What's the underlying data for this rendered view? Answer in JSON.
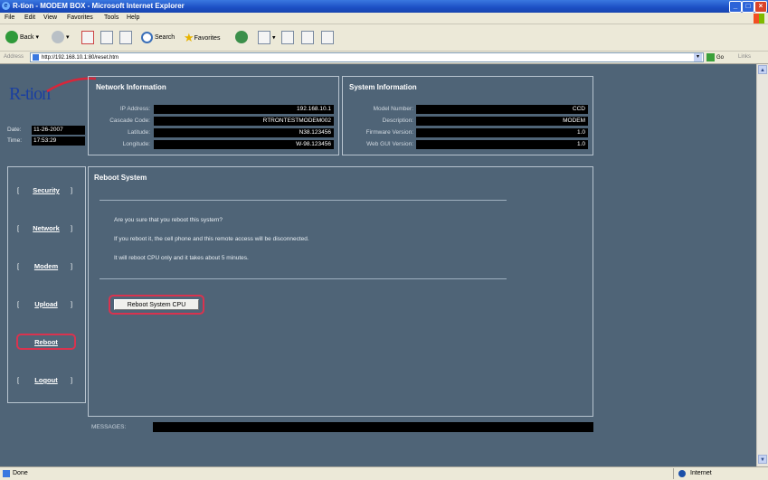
{
  "window": {
    "title": "R-tion - MODEM BOX - Microsoft Internet Explorer"
  },
  "menu": [
    "File",
    "Edit",
    "View",
    "Favorites",
    "Tools",
    "Help"
  ],
  "toolbar": {
    "back": "Back",
    "search": "Search",
    "favorites": "Favorites"
  },
  "address": {
    "label": "Address",
    "url": "http://192.168.10.1:80/reset.htm",
    "go": "Go",
    "links": "Links"
  },
  "status": {
    "text": "Done",
    "zone": "Internet"
  },
  "brand": {
    "logo": "R-tion"
  },
  "datetime": {
    "date_label": "Date:",
    "date": "11-26-2007",
    "time_label": "Time:",
    "time": "17:53:29"
  },
  "network": {
    "title": "Network Information",
    "rows": [
      {
        "label": "IP Address:",
        "value": "192.168.10.1"
      },
      {
        "label": "Cascade Code:",
        "value": "RTRONTESTMODEM002"
      },
      {
        "label": "Latitude:",
        "value": "N38.123456"
      },
      {
        "label": "Longitude:",
        "value": "W-98.123456"
      }
    ]
  },
  "system": {
    "title": "System Information",
    "rows": [
      {
        "label": "Model Number:",
        "value": "CCD"
      },
      {
        "label": "Description:",
        "value": "MODEM"
      },
      {
        "label": "Firmware Version:",
        "value": "1.0"
      },
      {
        "label": "Web GUI Version:",
        "value": "1.0"
      }
    ]
  },
  "nav": [
    {
      "label": "Security"
    },
    {
      "label": "Network"
    },
    {
      "label": "Modem"
    },
    {
      "label": "Upload"
    },
    {
      "label": "Reboot"
    },
    {
      "label": "Logout"
    }
  ],
  "reboot": {
    "title": "Reboot System",
    "line1": "Are you sure that you reboot this system?",
    "line2": "If you reboot it, the cell phone and this remote access will be disconnected.",
    "line3": "It will reboot CPU only and it takes about 5 minutes.",
    "button": "Reboot System CPU"
  },
  "messages": {
    "label": "MESSAGES:",
    "value": ""
  },
  "colors": {
    "page_bg": "#4f6477",
    "highlight": "#d9334f"
  }
}
